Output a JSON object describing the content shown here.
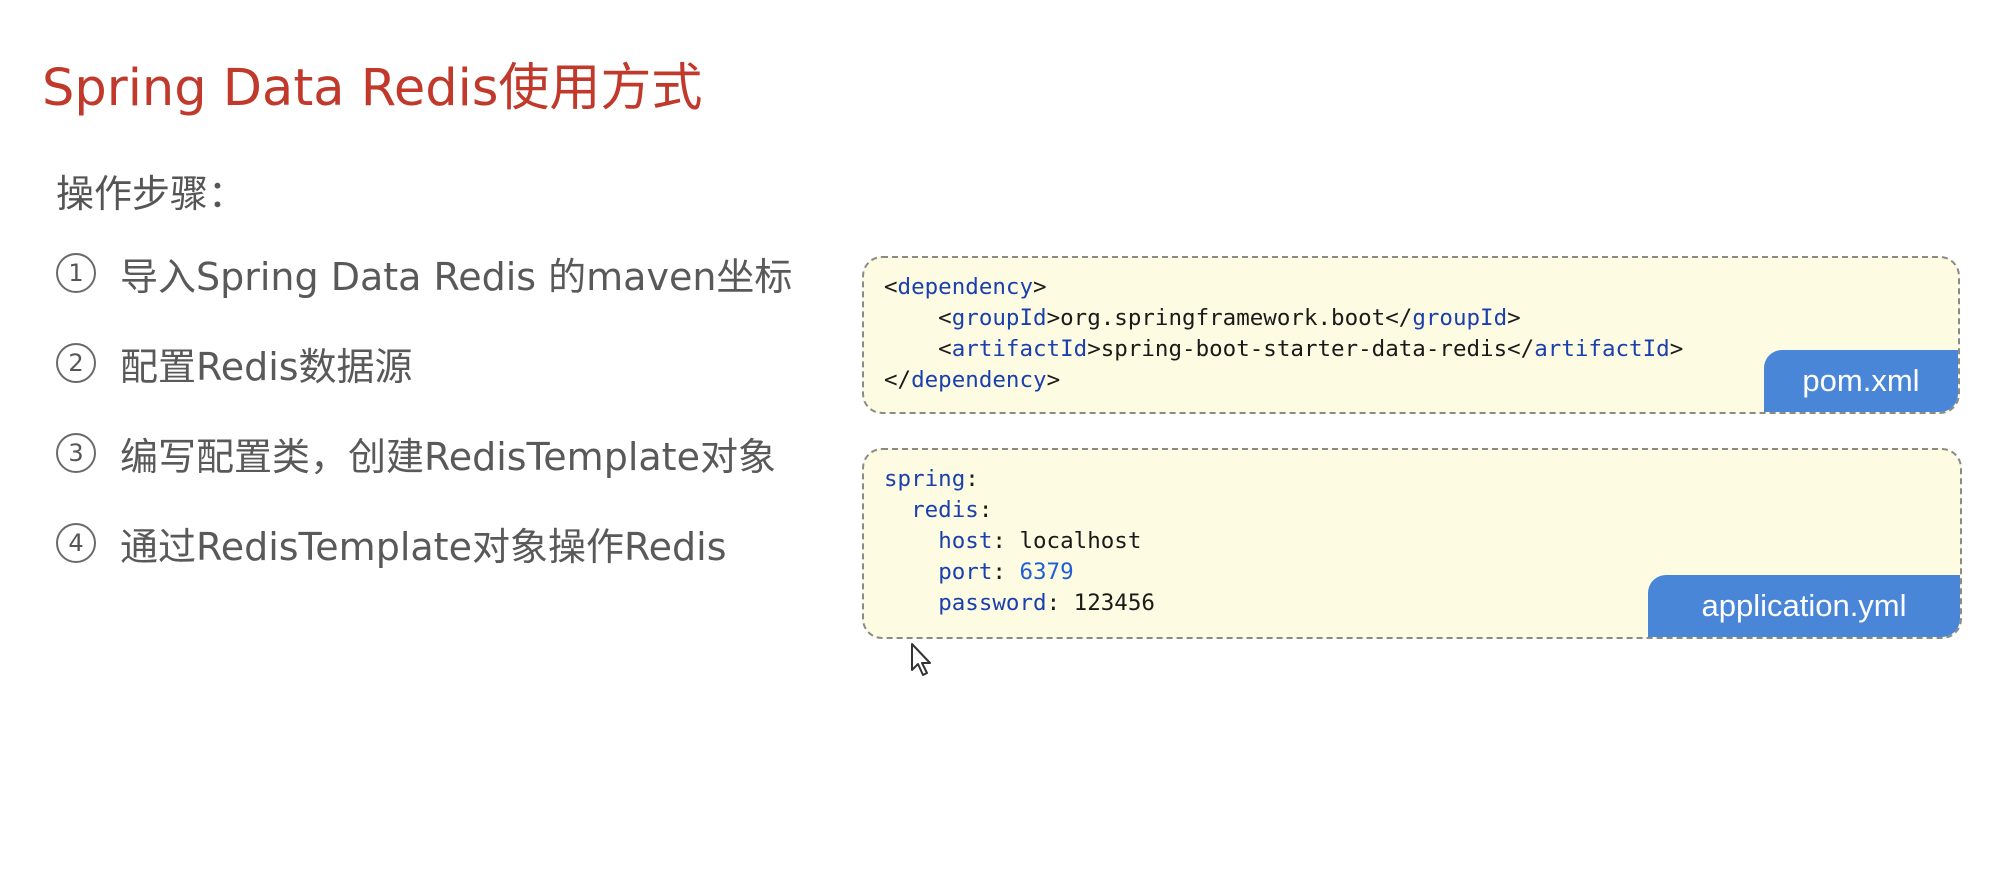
{
  "title": "Spring Data Redis使用方式",
  "section_label": "操作步骤：",
  "steps": [
    {
      "num": "1",
      "text": "导入Spring Data Redis 的maven坐标"
    },
    {
      "num": "2",
      "text": "配置Redis数据源"
    },
    {
      "num": "3",
      "text": "编写配置类，创建RedisTemplate对象"
    },
    {
      "num": "4",
      "text": "通过RedisTemplate对象操作Redis"
    }
  ],
  "pom_block": {
    "filename": "pom.xml",
    "tags": {
      "dependency": "dependency",
      "groupId": "groupId",
      "artifactId": "artifactId"
    },
    "group_id_value": "org.springframework.boot",
    "artifact_id_value": "spring-boot-starter-data-redis"
  },
  "yml_block": {
    "filename": "application.yml",
    "keys": {
      "spring": "spring",
      "redis": "redis",
      "host": "host",
      "port": "port",
      "password": "password"
    },
    "host_value": "localhost",
    "port_value": "6379",
    "password_value": "123456"
  },
  "colors": {
    "title": "#c0392b",
    "code_background": "#fdfbe1",
    "tag_background": "#4a86d8",
    "keyword": "#1a3fae"
  },
  "icons": {
    "cursor": "mouse-pointer-icon"
  }
}
